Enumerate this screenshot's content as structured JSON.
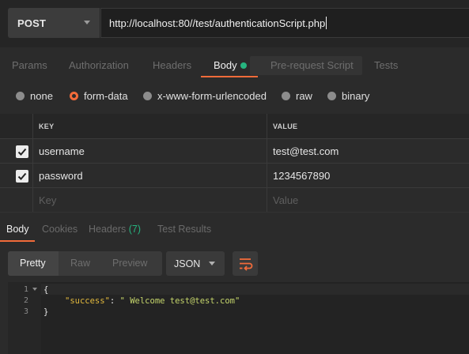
{
  "request": {
    "method": "POST",
    "url": "http://localhost:80//test/authenticationScript.php"
  },
  "request_tabs": [
    "Params",
    "Authorization",
    "Headers",
    "Body",
    "Pre-request Script",
    "Tests"
  ],
  "active_request_tab": "Body",
  "body_types": [
    "none",
    "form-data",
    "x-www-form-urlencoded",
    "raw",
    "binary"
  ],
  "selected_body_type": "form-data",
  "kv_table": {
    "headers": [
      "KEY",
      "VALUE"
    ],
    "rows": [
      {
        "key": "username",
        "value": "test@test.com",
        "checked": true
      },
      {
        "key": "password",
        "value": "1234567890",
        "checked": true
      }
    ],
    "placeholder": {
      "key": "Key",
      "value": "Value"
    }
  },
  "response_tabs": {
    "body": "Body",
    "cookies": "Cookies",
    "headers": "Headers",
    "headers_count": "(7)",
    "test_results": "Test Results"
  },
  "response_view": {
    "modes": [
      "Pretty",
      "Raw",
      "Preview"
    ],
    "active_mode": "Pretty",
    "format": "JSON"
  },
  "response_body": {
    "line_numbers": [
      "1",
      "2",
      "3"
    ],
    "open": "{",
    "key": "\"success\"",
    "colon": ": ",
    "value": "\" Welcome test@test.com\"",
    "close": "}"
  },
  "colors": {
    "accent": "#f26b3a",
    "status_green": "#26b47f",
    "json_key": "#e2b93d",
    "json_string": "#c5d56b"
  }
}
